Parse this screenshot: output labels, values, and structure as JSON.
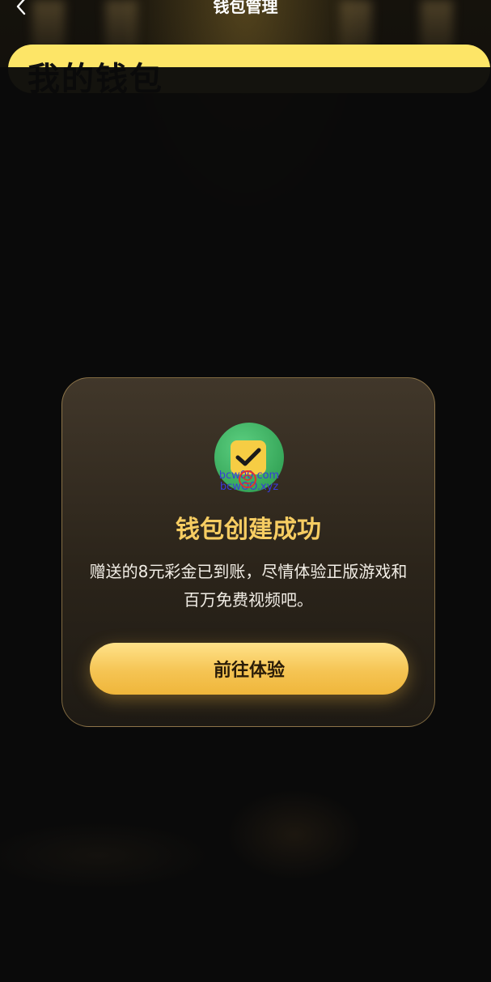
{
  "header": {
    "title": "钱包管理"
  },
  "wallet_card": {
    "title": "我的钱包"
  },
  "modal": {
    "icon": "check-badge-icon",
    "watermark_line1": "bcw00.com",
    "watermark_line2": "bcwOO.xyz",
    "title": "钱包创建成功",
    "message": "赠送的8元彩金已到账，尽情体验正版游戏和百万免费视频吧。",
    "button_label": "前往体验"
  },
  "colors": {
    "accent": "#f7cd62",
    "button": "#f5c453",
    "card": "#fde567",
    "success_green": "#37a75a"
  }
}
